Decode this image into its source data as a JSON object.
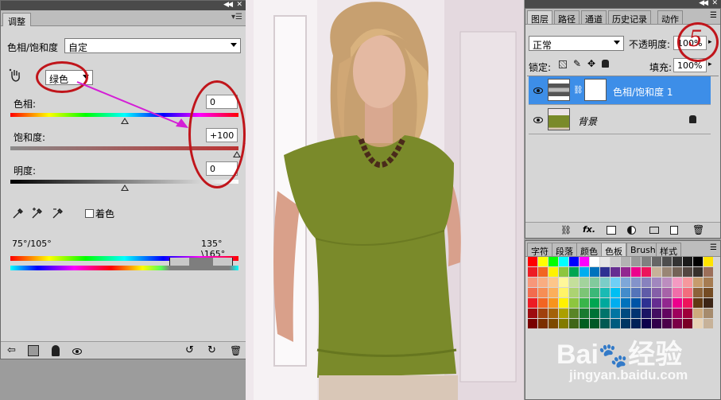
{
  "adjustments": {
    "tab": "调整",
    "title": "色相/饱和度",
    "preset": "自定",
    "channel": "绿色",
    "hue_label": "色相:",
    "hue_value": "0",
    "saturation_label": "饱和度:",
    "saturation_value": "+100",
    "lightness_label": "明度:",
    "lightness_value": "0",
    "colorize_label": "着色",
    "range_left": "75°/105°",
    "range_right": "135°\\165°"
  },
  "layers_panel": {
    "tabs": [
      "图层",
      "路径",
      "通道",
      "历史记录",
      "动作"
    ],
    "blend_mode": "正常",
    "opacity_label": "不透明度:",
    "opacity_value": "100%",
    "lock_label": "锁定:",
    "fill_label": "填充:",
    "fill_value": "100%",
    "layers": [
      {
        "name": "色相/饱和度 1",
        "selected": true
      },
      {
        "name": "背景",
        "selected": false
      }
    ],
    "bottom_fx": "fx."
  },
  "swatch_panel": {
    "tabs": [
      "字符",
      "段落",
      "颜色",
      "色板",
      "Brush",
      "样式"
    ],
    "colors": [
      "#ff0000",
      "#ffff00",
      "#00ff00",
      "#00ffff",
      "#0000ff",
      "#ff00ff",
      "#ffffff",
      "#e6e6e6",
      "#cccccc",
      "#b3b3b3",
      "#999999",
      "#808080",
      "#666666",
      "#4d4d4d",
      "#333333",
      "#1a1a1a",
      "#000000",
      "#ffe400",
      "#ed1c24",
      "#f26522",
      "#fff200",
      "#8dc63f",
      "#00a651",
      "#00aeef",
      "#0072bc",
      "#2e3192",
      "#662d91",
      "#92278f",
      "#ec008c",
      "#ed145b",
      "#c7b299",
      "#998675",
      "#736357",
      "#534741",
      "#37302b",
      "#9c6f5a",
      "#f7977a",
      "#f9ad81",
      "#fdc68a",
      "#fff79a",
      "#c4df9b",
      "#a3d39c",
      "#82ca9d",
      "#7bcdc8",
      "#6ecff6",
      "#7ea7d8",
      "#8493ca",
      "#8882be",
      "#a187be",
      "#bc8dbf",
      "#f49ac2",
      "#f6989d",
      "#c69c6d",
      "#a67c52",
      "#f26c4f",
      "#f68e55",
      "#fbaf5c",
      "#fff467",
      "#acd372",
      "#7cc576",
      "#3bb878",
      "#1abbb4",
      "#00bff3",
      "#438ccb",
      "#5574b9",
      "#605ca8",
      "#855fa8",
      "#a763a8",
      "#f06ea9",
      "#f26d7d",
      "#8c6239",
      "#754c24",
      "#ed1c24",
      "#f26522",
      "#f7941d",
      "#fff200",
      "#8dc63f",
      "#39b54a",
      "#00a651",
      "#00a99d",
      "#00aeef",
      "#0072bc",
      "#0054a6",
      "#2e3192",
      "#662d91",
      "#92278f",
      "#ec008c",
      "#ed145b",
      "#603913",
      "#3c2415",
      "#9e0b0f",
      "#a0410d",
      "#a36209",
      "#aba000",
      "#598527",
      "#1a7b30",
      "#007236",
      "#00746b",
      "#0076a3",
      "#004a80",
      "#003471",
      "#1b1464",
      "#440e62",
      "#630460",
      "#9e005d",
      "#9e0039",
      "#cdaa7d",
      "#a68b6d",
      "#790000",
      "#7b2e00",
      "#7d4900",
      "#827b00",
      "#406618",
      "#005e20",
      "#005826",
      "#005952",
      "#005b7f",
      "#003663",
      "#002157",
      "#0d004c",
      "#32004b",
      "#4b0049",
      "#7b0046",
      "#7a0026",
      "#e8d3b5",
      "#c7b299"
    ]
  }
}
